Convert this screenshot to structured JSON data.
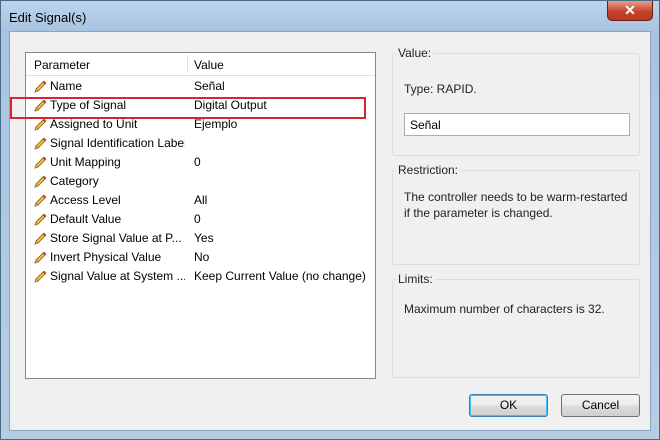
{
  "window": {
    "title": "Edit Signal(s)",
    "close_glyph": "✕"
  },
  "grid": {
    "headers": {
      "parameter": "Parameter",
      "value": "Value"
    },
    "rows": [
      {
        "name": "Name",
        "value": "Señal"
      },
      {
        "name": "Type of Signal",
        "value": "Digital Output"
      },
      {
        "name": "Assigned to Unit",
        "value": "Ejemplo"
      },
      {
        "name": "Signal Identification Label",
        "value": ""
      },
      {
        "name": "Unit Mapping",
        "value": "0"
      },
      {
        "name": "Category",
        "value": ""
      },
      {
        "name": "Access Level",
        "value": "All"
      },
      {
        "name": "Default Value",
        "value": "0"
      },
      {
        "name": "Store Signal Value at P...",
        "value": "Yes"
      },
      {
        "name": "Invert Physical Value",
        "value": "No"
      },
      {
        "name": "Signal Value at System ...",
        "value": "Keep Current Value (no change)"
      }
    ],
    "row_icon": "pencil-icon",
    "highlight_color": "#d6262f"
  },
  "value_panel": {
    "label": "Value:",
    "type_text": "Type: RAPID.",
    "input_value": "Señal"
  },
  "restriction_panel": {
    "label": "Restriction:",
    "text": "The controller needs to be warm-restarted if the parameter is changed."
  },
  "limits_panel": {
    "label": "Limits:",
    "text": "Maximum number of characters is 32."
  },
  "buttons": {
    "ok": "OK",
    "cancel": "Cancel"
  }
}
